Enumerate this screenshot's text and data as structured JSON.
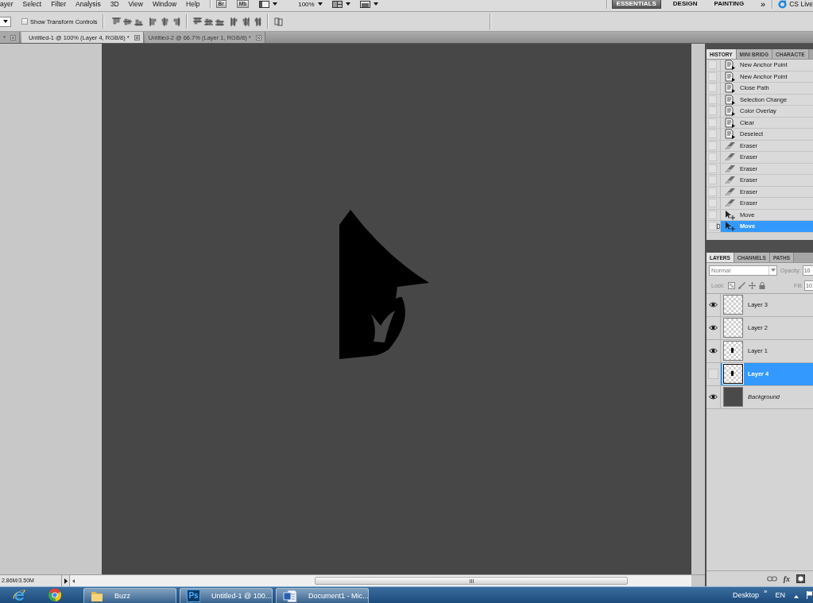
{
  "menu_bar": {
    "items": [
      "ayer",
      "Select",
      "Filter",
      "Analysis",
      "3D",
      "View",
      "Window",
      "Help"
    ],
    "bridge_buttons": [
      "Br",
      "Mb"
    ],
    "zoom": "100%",
    "workspaces": [
      {
        "label": "ESSENTIALS",
        "selected": true
      },
      {
        "label": "DESIGN",
        "selected": false
      },
      {
        "label": "PAINTING",
        "selected": false
      }
    ],
    "more": "»",
    "cs_live": "CS Live"
  },
  "options_bar": {
    "transform_controls": {
      "label": "Show Transform Controls",
      "checked": false
    }
  },
  "document_tabs": [
    {
      "label": "*",
      "selected": false
    },
    {
      "label": "Untitled-1 @ 100% (Layer 4, RGB/8) *",
      "selected": true
    },
    {
      "label": "Untitled-2 @ 66.7% (Layer 1, RGB/8) *",
      "selected": false
    }
  ],
  "history_panel": {
    "tabs": [
      {
        "label": "HISTORY",
        "selected": true
      },
      {
        "label": "MINI BRIDG",
        "selected": false
      },
      {
        "label": "CHARACTE",
        "selected": false
      }
    ],
    "items": [
      {
        "label": "New Anchor Point",
        "kind": "document",
        "selected": false
      },
      {
        "label": "New Anchor Point",
        "kind": "document",
        "selected": false
      },
      {
        "label": "Close Path",
        "kind": "document",
        "selected": false
      },
      {
        "label": "Selection Change",
        "kind": "document",
        "selected": false
      },
      {
        "label": "Color Overlay",
        "kind": "document",
        "selected": false
      },
      {
        "label": "Clear",
        "kind": "document",
        "selected": false
      },
      {
        "label": "Deselect",
        "kind": "document",
        "selected": false
      },
      {
        "label": "Eraser",
        "kind": "eraser",
        "selected": false
      },
      {
        "label": "Eraser",
        "kind": "eraser",
        "selected": false
      },
      {
        "label": "Eraser",
        "kind": "eraser",
        "selected": false
      },
      {
        "label": "Eraser",
        "kind": "eraser",
        "selected": false
      },
      {
        "label": "Eraser",
        "kind": "eraser",
        "selected": false
      },
      {
        "label": "Eraser",
        "kind": "eraser",
        "selected": false
      },
      {
        "label": "Move",
        "kind": "move",
        "selected": false
      },
      {
        "label": "Move",
        "kind": "move",
        "selected": true
      }
    ]
  },
  "layers_panel": {
    "tabs": [
      {
        "label": "LAYERS",
        "selected": true
      },
      {
        "label": "CHANNELS",
        "selected": false
      },
      {
        "label": "PATHS",
        "selected": false
      }
    ],
    "blend_mode": "Normal",
    "opacity_label": "Opacity:",
    "opacity_value": "10",
    "lock_label": "Lock:",
    "fill_label": "Fill:",
    "fill_value": "10",
    "layers": [
      {
        "name": "Layer 3",
        "kind": "empty",
        "visible": true,
        "selected": false
      },
      {
        "name": "Layer 2",
        "kind": "empty",
        "visible": true,
        "selected": false
      },
      {
        "name": "Layer 1",
        "kind": "content",
        "visible": true,
        "selected": false
      },
      {
        "name": "Layer 4",
        "kind": "content",
        "visible": false,
        "selected": true
      },
      {
        "name": "Background",
        "kind": "background",
        "visible": true,
        "selected": false
      }
    ],
    "effects_button": "fx"
  },
  "status_bar": {
    "document_size": "2.86M/3.50M"
  },
  "taskbar": {
    "buttons": [
      {
        "label": "Buzz",
        "kind": "folder"
      },
      {
        "label": "Untitled-1 @ 100...",
        "kind": "photoshop",
        "badge": "Ps"
      },
      {
        "label": "Document1 - Mic...",
        "kind": "word"
      }
    ],
    "desktop": "Desktop",
    "more": "»",
    "language": "EN"
  }
}
